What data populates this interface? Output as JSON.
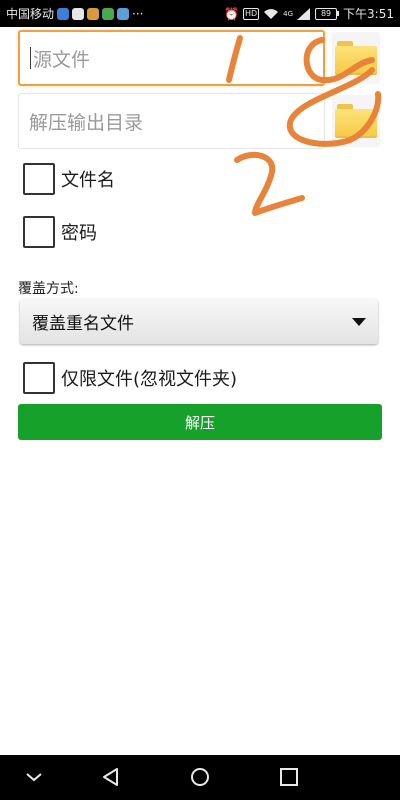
{
  "status_bar": {
    "carrier": "中国移动",
    "more": "···",
    "hd": "HD",
    "signal_small": "4G",
    "battery": "89",
    "time": "下午3:51"
  },
  "form": {
    "source_placeholder": "源文件",
    "output_placeholder": "解压输出目录",
    "checkbox_filename": "文件名",
    "checkbox_password": "密码",
    "overwrite_label": "覆盖方式:",
    "overwrite_selected": "覆盖重名文件",
    "checkbox_files_only": "仅限文件(忽视文件夹)",
    "extract_button": "解压"
  },
  "annotations": {
    "color": "#e8843a"
  },
  "colors": {
    "accent_green": "#16a12a",
    "focus_orange": "#f0a040"
  }
}
